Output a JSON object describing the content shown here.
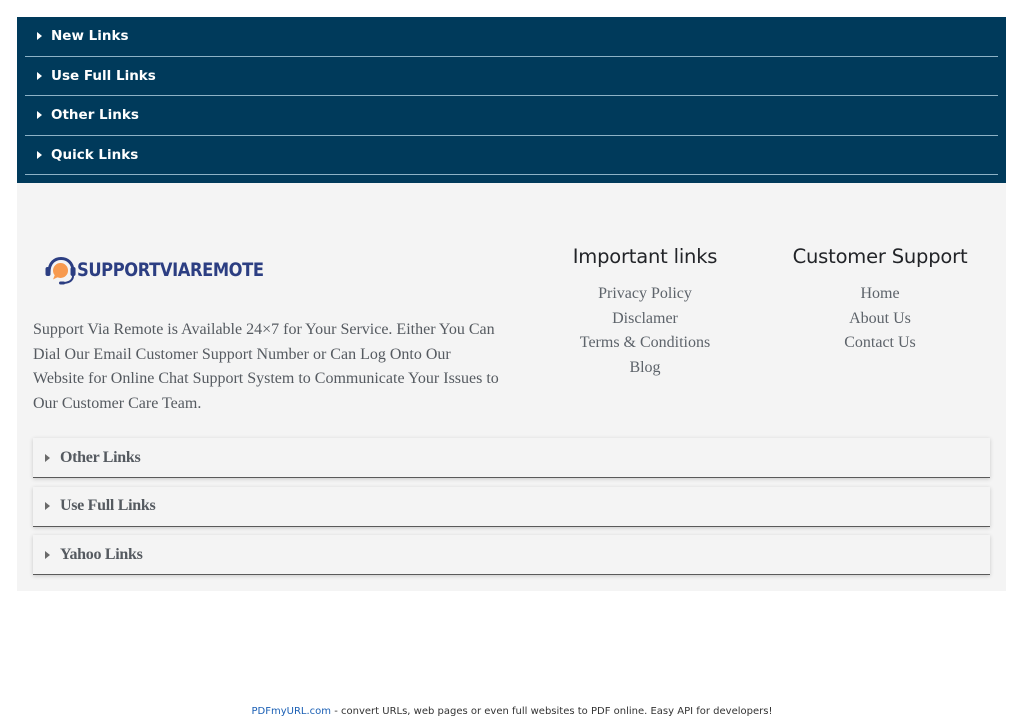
{
  "top_accordion": {
    "items": [
      {
        "label": "New Links"
      },
      {
        "label": "Use Full Links"
      },
      {
        "label": "Other Links"
      },
      {
        "label": "Quick Links"
      }
    ]
  },
  "footer": {
    "logo": {
      "text": "SUPPORTVIAREMOTE"
    },
    "description": "Support Via Remote is Available 24×7 for Your Service. Either You Can Dial Our Email Customer Support Number or Can Log Onto Our Website for Online Chat Support System to Communicate Your Issues to Our Customer Care Team.",
    "important_links": {
      "title": "Important links",
      "items": [
        "Privacy Policy",
        "Disclamer",
        "Terms & Conditions",
        "Blog"
      ]
    },
    "customer_support": {
      "title": "Customer Support",
      "items": [
        "Home",
        "About Us",
        "Contact Us"
      ]
    },
    "accordion": {
      "items": [
        {
          "label": "Other Links"
        },
        {
          "label": "Use Full Links"
        },
        {
          "label": "Yahoo Links"
        }
      ]
    }
  },
  "pdf_bar": {
    "brand": "PDFmyURL.com",
    "text": " - convert URLs, web pages or even full websites to PDF online. Easy API for developers!"
  },
  "colors": {
    "top_bg": "#003a5b",
    "footer_bg": "#f4f4f4",
    "logo_orange": "#f79a4f",
    "logo_navy": "#2c3e82"
  }
}
